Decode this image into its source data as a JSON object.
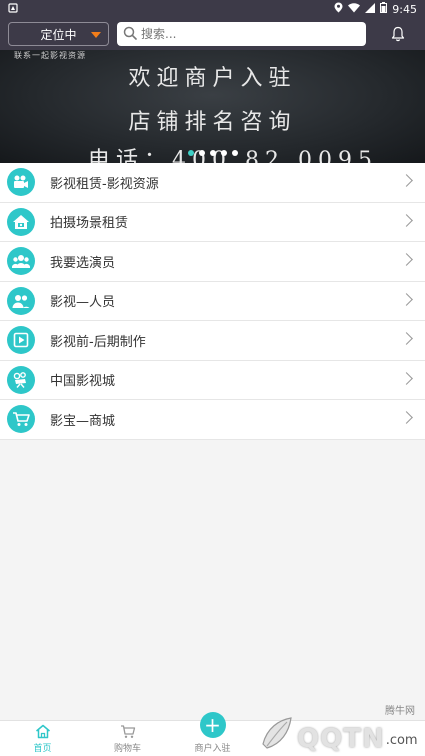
{
  "status_bar": {
    "time": "9:45"
  },
  "header": {
    "location_label": "定位中",
    "search_placeholder": "搜索..."
  },
  "banner": {
    "tiny_text": "联系一起影视资源",
    "line1": "欢迎商户入驻",
    "line2": "店铺排名咨询",
    "line3": "电话：400 82 0095",
    "dot_count": 5,
    "active_dot": 0
  },
  "menu": [
    {
      "label": "影视租赁-影视资源",
      "icon": "video-camera-icon"
    },
    {
      "label": "拍摄场景租赁",
      "icon": "scene-house-icon"
    },
    {
      "label": "我要选演员",
      "icon": "actors-group-icon"
    },
    {
      "label": "影视—人员",
      "icon": "people-icon"
    },
    {
      "label": "影视前-后期制作",
      "icon": "film-play-icon"
    },
    {
      "label": "中国影视城",
      "icon": "film-city-icon"
    },
    {
      "label": "影宝—商城",
      "icon": "shopping-cart-icon"
    }
  ],
  "tabbar": {
    "home": "首页",
    "cart": "购物车",
    "merchant": "商户入驻"
  },
  "watermark": {
    "brand": "QQTN",
    "small": "腾牛网",
    "domain": ".com"
  },
  "colors": {
    "accent": "#2ec7c9",
    "header_bg": "#3d3a48",
    "caret": "#f27d1a"
  }
}
